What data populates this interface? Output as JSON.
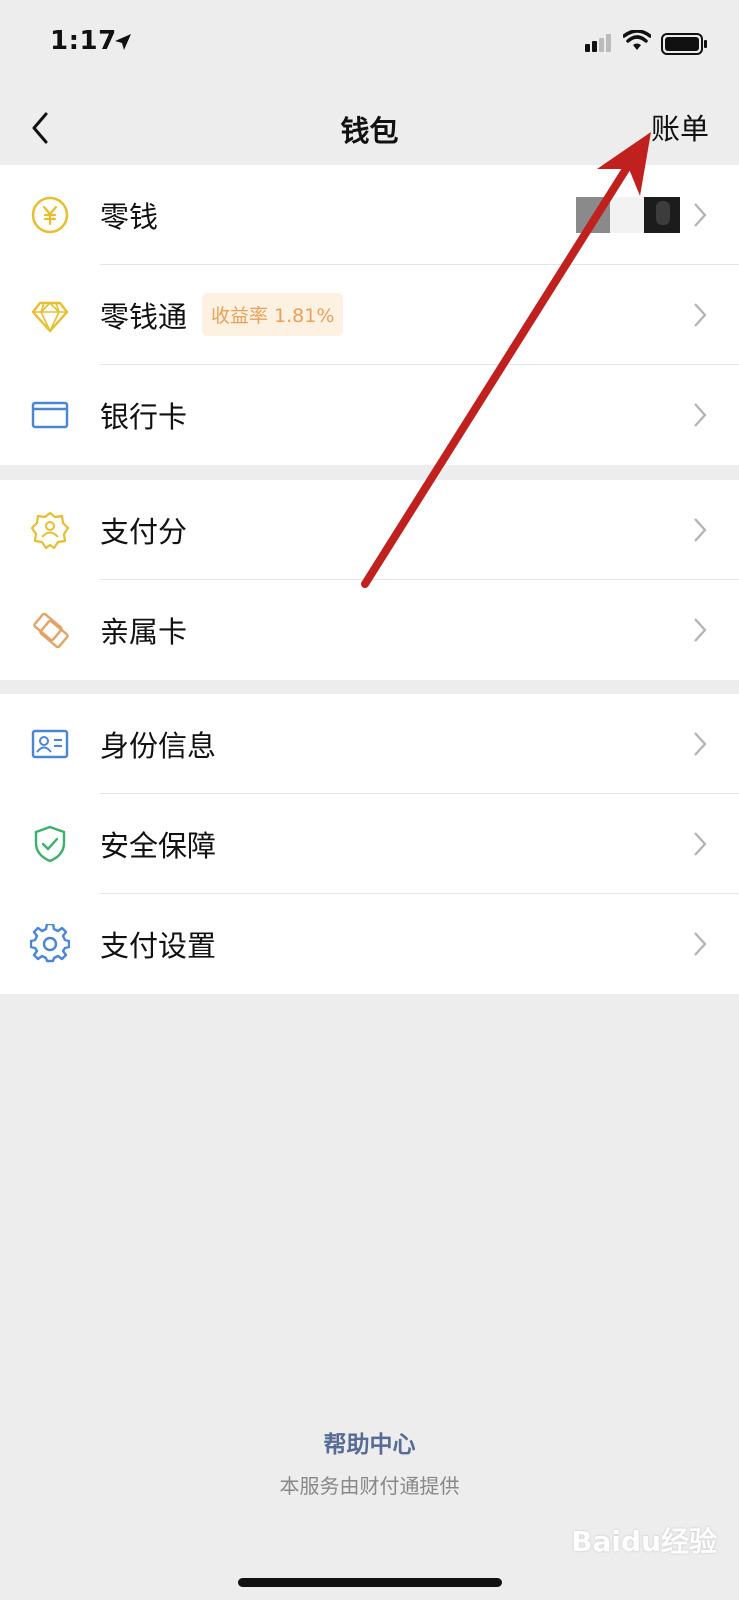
{
  "status_bar": {
    "time": "1:17"
  },
  "nav": {
    "title": "钱包",
    "right_action": "账单"
  },
  "groups": [
    {
      "items": [
        {
          "label": "零钱",
          "icon": "yuan-coin-icon"
        },
        {
          "label": "零钱通",
          "icon": "diamond-icon",
          "badge": "收益率 1.81%"
        },
        {
          "label": "银行卡",
          "icon": "bank-card-icon"
        }
      ]
    },
    {
      "items": [
        {
          "label": "支付分",
          "icon": "credit-score-icon"
        },
        {
          "label": "亲属卡",
          "icon": "family-card-icon"
        }
      ]
    },
    {
      "items": [
        {
          "label": "身份信息",
          "icon": "id-card-icon"
        },
        {
          "label": "安全保障",
          "icon": "shield-check-icon"
        },
        {
          "label": "支付设置",
          "icon": "gear-icon"
        }
      ]
    }
  ],
  "footer": {
    "help": "帮助中心",
    "note": "本服务由财付通提供"
  },
  "watermark": "Baidu经验",
  "colors": {
    "accent_link": "#576b95",
    "badge_text": "#e8a158",
    "badge_bg": "#fdf1e2",
    "annotation_arrow": "#c0201e"
  }
}
